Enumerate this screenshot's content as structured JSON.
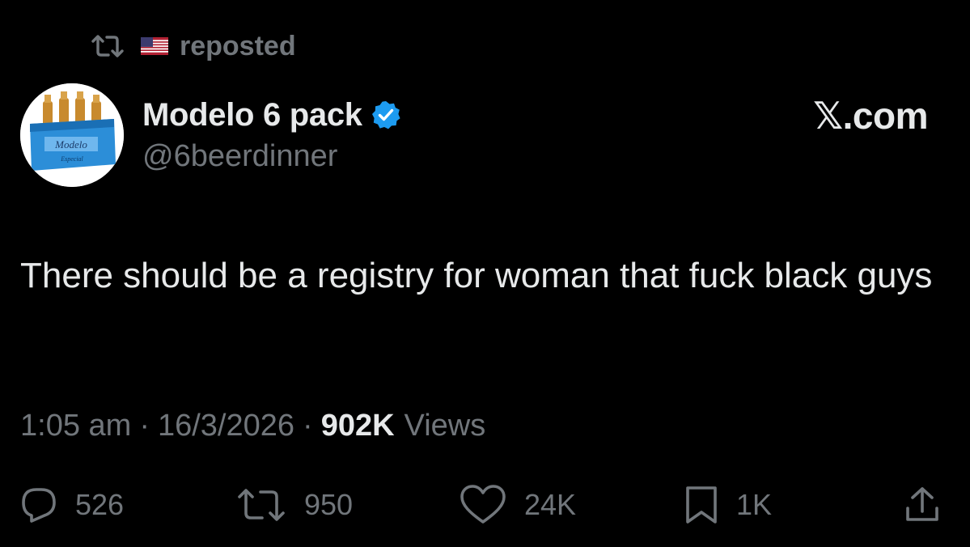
{
  "repost": {
    "label": "reposted",
    "icon": "repost-icon",
    "flag": "us-flag"
  },
  "author": {
    "display_name": "Modelo 6 pack",
    "handle": "@6beerdinner",
    "verified": true,
    "avatar_text": "Modelo",
    "avatar_subtext": "Especial"
  },
  "brand": "𝕏.com",
  "tweet": {
    "text": "There should be a registry for woman that fuck black guys"
  },
  "meta": {
    "time": "1:05 am",
    "separator": "·",
    "date": "16/3/2026",
    "views_count": "902K",
    "views_label": "Views"
  },
  "actions": {
    "replies": "526",
    "reposts": "950",
    "likes": "24K",
    "bookmarks": "1K"
  },
  "colors": {
    "background": "#000000",
    "text": "#e7e9ea",
    "muted": "#71767b",
    "verified": "#1d9bf0"
  }
}
